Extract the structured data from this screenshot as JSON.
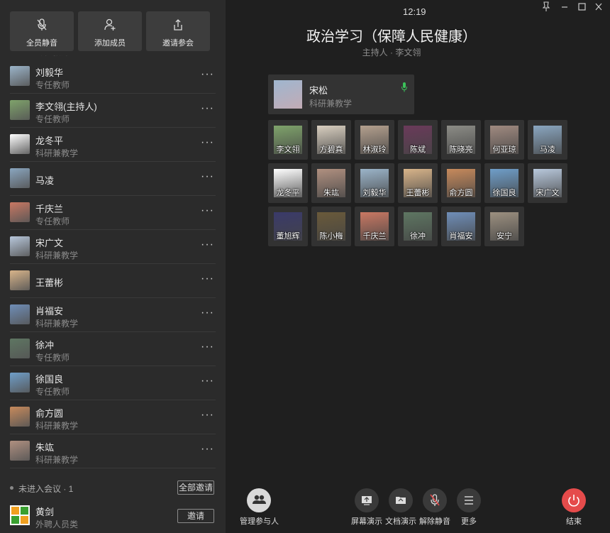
{
  "top_actions": [
    {
      "label": "全员静音",
      "icon": "mic-off-icon"
    },
    {
      "label": "添加成员",
      "icon": "add-user-icon"
    },
    {
      "label": "邀请参会",
      "icon": "share-icon"
    }
  ],
  "partial_role": "专任教师",
  "members": [
    {
      "name": "刘毅华",
      "role": "专任教师",
      "color": "#9bb4c9"
    },
    {
      "name": "李文翎(主持人)",
      "role": "专任教师",
      "color": "#7fa36b"
    },
    {
      "name": "龙冬平",
      "role": "科研兼教学",
      "color": "#ffffff"
    },
    {
      "name": "马凌",
      "role": "",
      "color": "#8aa6c0"
    },
    {
      "name": "千庆兰",
      "role": "专任教师",
      "color": "#c97863"
    },
    {
      "name": "宋广文",
      "role": "科研兼教学",
      "color": "#b8c8dc"
    },
    {
      "name": "王蕾彬",
      "role": "",
      "color": "#d8b48a"
    },
    {
      "name": "肖福安",
      "role": "科研兼教学",
      "color": "#6f8eb8"
    },
    {
      "name": "徐冲",
      "role": "专任教师",
      "color": "#5e7662"
    },
    {
      "name": "徐国良",
      "role": "专任教师",
      "color": "#6f9ec9"
    },
    {
      "name": "俞方圆",
      "role": "科研兼教学",
      "color": "#c78a5c"
    },
    {
      "name": "朱竑",
      "role": "科研兼教学",
      "color": "#b09080"
    }
  ],
  "not_joined": {
    "label": "未进入会议 · 1",
    "invite_all": "全部邀请"
  },
  "invitee": {
    "name": "黄剑",
    "role": "外聘人员类",
    "invite": "邀请"
  },
  "clock": "12:19",
  "title": "政治学习（保障人民健康）",
  "host": "主持人 · 李文翎",
  "speaker": {
    "name": "宋松",
    "role": "科研兼教学",
    "color": "#9fb6cf"
  },
  "grid": [
    {
      "name": "李文翎",
      "color": "#7fa36b"
    },
    {
      "name": "方碧真",
      "color": "#d9cfc0"
    },
    {
      "name": "林淑玲",
      "color": "#b4a08e"
    },
    {
      "name": "陈斌",
      "color": "#6a3a5a"
    },
    {
      "name": "陈晓亮",
      "color": "#8c8c86"
    },
    {
      "name": "何亚琼",
      "color": "#a08a80"
    },
    {
      "name": "马凌",
      "color": "#8aa6c0"
    },
    {
      "name": "龙冬平",
      "color": "#ffffff"
    },
    {
      "name": "朱竑",
      "color": "#b09080"
    },
    {
      "name": "刘毅华",
      "color": "#9bb4c9"
    },
    {
      "name": "王蕾彬",
      "color": "#d8b48a"
    },
    {
      "name": "俞方圆",
      "color": "#c78a5c"
    },
    {
      "name": "徐国良",
      "color": "#6f9ec9"
    },
    {
      "name": "宋广文",
      "color": "#b8c8dc"
    },
    {
      "name": "董旭辉",
      "color": "#3a3a6a"
    },
    {
      "name": "陈小梅",
      "color": "#6a5a3a"
    },
    {
      "name": "千庆兰",
      "color": "#c97863"
    },
    {
      "name": "徐冲",
      "color": "#5e7662"
    },
    {
      "name": "肖福安",
      "color": "#6f8eb8"
    },
    {
      "name": "安宁",
      "color": "#9c9080"
    }
  ],
  "toolbar": {
    "manage": "管理参与人",
    "screen_share": "屏幕演示",
    "doc_share": "文档演示",
    "unmute": "解除静音",
    "more": "更多",
    "end": "结束"
  }
}
